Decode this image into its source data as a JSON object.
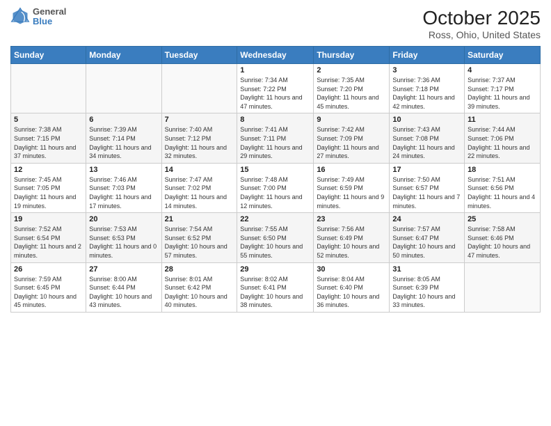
{
  "header": {
    "logo_line1": "General",
    "logo_line2": "Blue",
    "title": "October 2025",
    "subtitle": "Ross, Ohio, United States"
  },
  "days_of_week": [
    "Sunday",
    "Monday",
    "Tuesday",
    "Wednesday",
    "Thursday",
    "Friday",
    "Saturday"
  ],
  "weeks": [
    [
      {
        "day": "",
        "info": ""
      },
      {
        "day": "",
        "info": ""
      },
      {
        "day": "",
        "info": ""
      },
      {
        "day": "1",
        "info": "Sunrise: 7:34 AM\nSunset: 7:22 PM\nDaylight: 11 hours\nand 47 minutes."
      },
      {
        "day": "2",
        "info": "Sunrise: 7:35 AM\nSunset: 7:20 PM\nDaylight: 11 hours\nand 45 minutes."
      },
      {
        "day": "3",
        "info": "Sunrise: 7:36 AM\nSunset: 7:18 PM\nDaylight: 11 hours\nand 42 minutes."
      },
      {
        "day": "4",
        "info": "Sunrise: 7:37 AM\nSunset: 7:17 PM\nDaylight: 11 hours\nand 39 minutes."
      }
    ],
    [
      {
        "day": "5",
        "info": "Sunrise: 7:38 AM\nSunset: 7:15 PM\nDaylight: 11 hours\nand 37 minutes."
      },
      {
        "day": "6",
        "info": "Sunrise: 7:39 AM\nSunset: 7:14 PM\nDaylight: 11 hours\nand 34 minutes."
      },
      {
        "day": "7",
        "info": "Sunrise: 7:40 AM\nSunset: 7:12 PM\nDaylight: 11 hours\nand 32 minutes."
      },
      {
        "day": "8",
        "info": "Sunrise: 7:41 AM\nSunset: 7:11 PM\nDaylight: 11 hours\nand 29 minutes."
      },
      {
        "day": "9",
        "info": "Sunrise: 7:42 AM\nSunset: 7:09 PM\nDaylight: 11 hours\nand 27 minutes."
      },
      {
        "day": "10",
        "info": "Sunrise: 7:43 AM\nSunset: 7:08 PM\nDaylight: 11 hours\nand 24 minutes."
      },
      {
        "day": "11",
        "info": "Sunrise: 7:44 AM\nSunset: 7:06 PM\nDaylight: 11 hours\nand 22 minutes."
      }
    ],
    [
      {
        "day": "12",
        "info": "Sunrise: 7:45 AM\nSunset: 7:05 PM\nDaylight: 11 hours\nand 19 minutes."
      },
      {
        "day": "13",
        "info": "Sunrise: 7:46 AM\nSunset: 7:03 PM\nDaylight: 11 hours\nand 17 minutes."
      },
      {
        "day": "14",
        "info": "Sunrise: 7:47 AM\nSunset: 7:02 PM\nDaylight: 11 hours\nand 14 minutes."
      },
      {
        "day": "15",
        "info": "Sunrise: 7:48 AM\nSunset: 7:00 PM\nDaylight: 11 hours\nand 12 minutes."
      },
      {
        "day": "16",
        "info": "Sunrise: 7:49 AM\nSunset: 6:59 PM\nDaylight: 11 hours\nand 9 minutes."
      },
      {
        "day": "17",
        "info": "Sunrise: 7:50 AM\nSunset: 6:57 PM\nDaylight: 11 hours\nand 7 minutes."
      },
      {
        "day": "18",
        "info": "Sunrise: 7:51 AM\nSunset: 6:56 PM\nDaylight: 11 hours\nand 4 minutes."
      }
    ],
    [
      {
        "day": "19",
        "info": "Sunrise: 7:52 AM\nSunset: 6:54 PM\nDaylight: 11 hours\nand 2 minutes."
      },
      {
        "day": "20",
        "info": "Sunrise: 7:53 AM\nSunset: 6:53 PM\nDaylight: 11 hours\nand 0 minutes."
      },
      {
        "day": "21",
        "info": "Sunrise: 7:54 AM\nSunset: 6:52 PM\nDaylight: 10 hours\nand 57 minutes."
      },
      {
        "day": "22",
        "info": "Sunrise: 7:55 AM\nSunset: 6:50 PM\nDaylight: 10 hours\nand 55 minutes."
      },
      {
        "day": "23",
        "info": "Sunrise: 7:56 AM\nSunset: 6:49 PM\nDaylight: 10 hours\nand 52 minutes."
      },
      {
        "day": "24",
        "info": "Sunrise: 7:57 AM\nSunset: 6:47 PM\nDaylight: 10 hours\nand 50 minutes."
      },
      {
        "day": "25",
        "info": "Sunrise: 7:58 AM\nSunset: 6:46 PM\nDaylight: 10 hours\nand 47 minutes."
      }
    ],
    [
      {
        "day": "26",
        "info": "Sunrise: 7:59 AM\nSunset: 6:45 PM\nDaylight: 10 hours\nand 45 minutes."
      },
      {
        "day": "27",
        "info": "Sunrise: 8:00 AM\nSunset: 6:44 PM\nDaylight: 10 hours\nand 43 minutes."
      },
      {
        "day": "28",
        "info": "Sunrise: 8:01 AM\nSunset: 6:42 PM\nDaylight: 10 hours\nand 40 minutes."
      },
      {
        "day": "29",
        "info": "Sunrise: 8:02 AM\nSunset: 6:41 PM\nDaylight: 10 hours\nand 38 minutes."
      },
      {
        "day": "30",
        "info": "Sunrise: 8:04 AM\nSunset: 6:40 PM\nDaylight: 10 hours\nand 36 minutes."
      },
      {
        "day": "31",
        "info": "Sunrise: 8:05 AM\nSunset: 6:39 PM\nDaylight: 10 hours\nand 33 minutes."
      },
      {
        "day": "",
        "info": ""
      }
    ]
  ]
}
